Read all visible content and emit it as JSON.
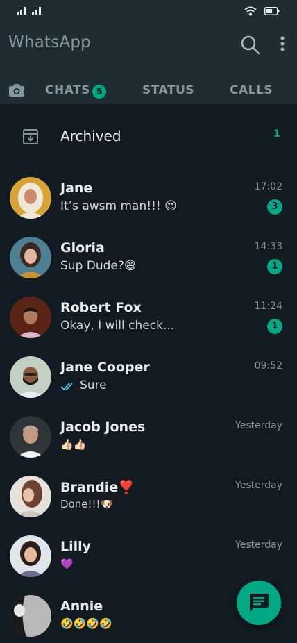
{
  "header": {
    "app_title": "WhatsApp"
  },
  "tabs": {
    "chats": "CHATS",
    "chats_badge": "5",
    "status": "STATUS",
    "calls": "CALLS"
  },
  "archived": {
    "label": "Archived",
    "count": "1"
  },
  "chats": [
    {
      "name": "Jane",
      "message": "It’s awsm man!!! 😍",
      "time": "17:02",
      "unread": "3"
    },
    {
      "name": "Gloria",
      "message": "Sup Dude?😅",
      "time": "14:33",
      "unread": "1"
    },
    {
      "name": "Robert Fox",
      "message": "Okay, I will check...",
      "time": "11:24",
      "unread": "1"
    },
    {
      "name": "Jane Cooper",
      "message": "Sure",
      "time": "09:52"
    },
    {
      "name": "Jacob Jones",
      "message": "👍🏻👍🏻",
      "time": "Yesterday"
    },
    {
      "name": "Brandie❣️",
      "message": "Done!!!🐶",
      "time": "Yesterday"
    },
    {
      "name": "Lilly",
      "message": "💜",
      "time": "Yesterday"
    },
    {
      "name": "Annie",
      "message": "🤣🤣🤣🤣",
      "time": "2"
    }
  ],
  "colors": {
    "background": "#111b21",
    "header": "#1f2c34",
    "accent": "#00a884",
    "read_ticks": "#53bdeb"
  },
  "icons": {
    "search": "search-icon",
    "menu": "more-vert-icon",
    "camera": "camera-icon",
    "archive": "archive-icon",
    "fab": "new-chat-icon"
  }
}
